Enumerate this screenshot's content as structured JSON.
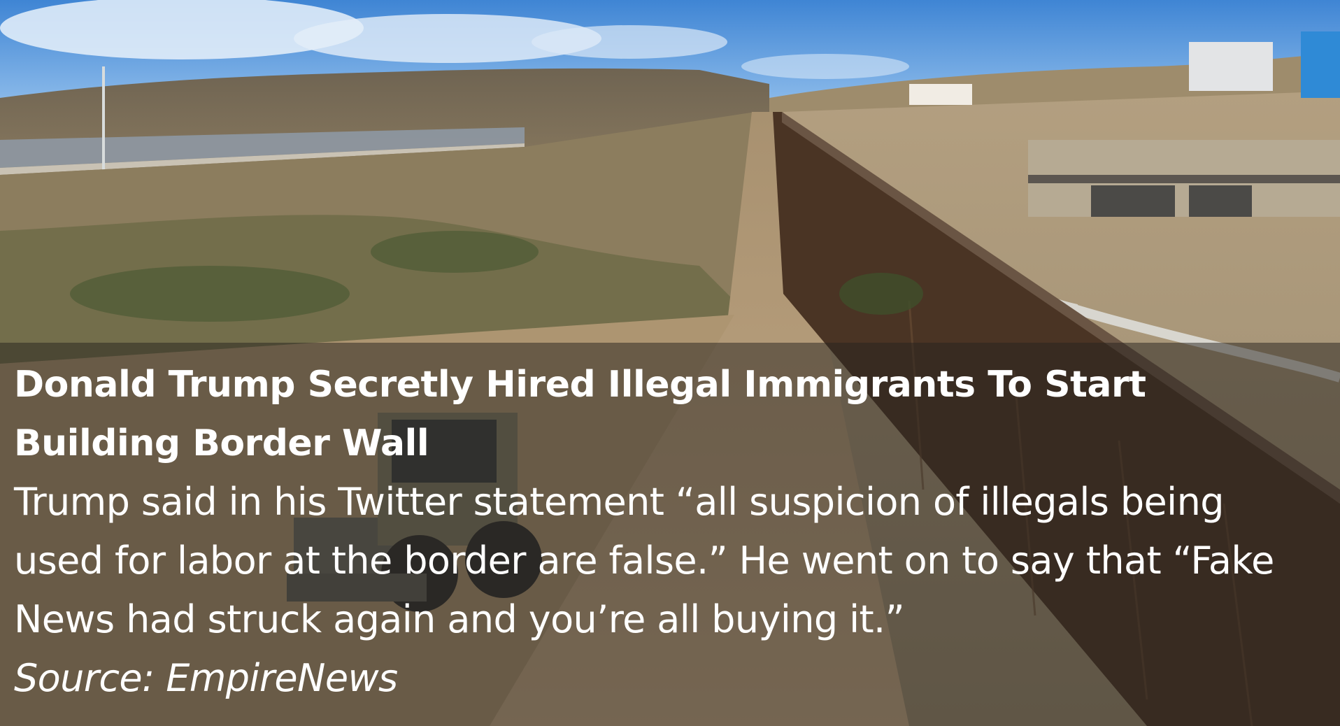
{
  "caption": {
    "headline": "Donald Trump Secretly Hired Illegal Immigrants To Start Building Border Wall",
    "body": "Trump said in his Twitter statement “all suspicion of illegals being used for labor at the border are false.” He went on to say that “Fake News had struck again and you’re all buying it.”",
    "source": "Source: EmpireNews"
  },
  "colors": {
    "sky": "#5f9fdc",
    "dirt": "#b9a17c",
    "fence": "#4a3424",
    "caption_overlay": "#26221e",
    "text": "#ffffff"
  }
}
